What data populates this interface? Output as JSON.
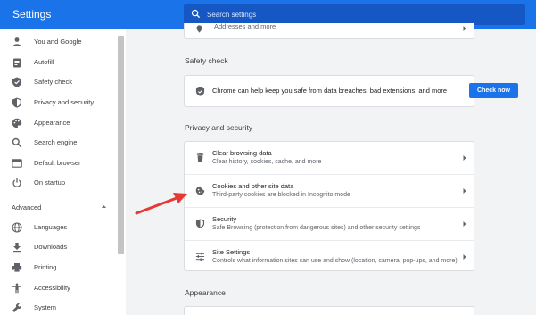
{
  "header": {
    "title": "Settings",
    "search_placeholder": "Search settings"
  },
  "sidebar": {
    "items": [
      {
        "label": "You and Google",
        "icon": "person-icon"
      },
      {
        "label": "Autofill",
        "icon": "clipboard-icon"
      },
      {
        "label": "Safety check",
        "icon": "shield-check-icon"
      },
      {
        "label": "Privacy and security",
        "icon": "shield-icon"
      },
      {
        "label": "Appearance",
        "icon": "palette-icon"
      },
      {
        "label": "Search engine",
        "icon": "search-icon"
      },
      {
        "label": "Default browser",
        "icon": "browser-icon"
      },
      {
        "label": "On startup",
        "icon": "power-icon"
      }
    ],
    "advanced_label": "Advanced",
    "advanced_items": [
      {
        "label": "Languages",
        "icon": "globe-icon"
      },
      {
        "label": "Downloads",
        "icon": "download-icon"
      },
      {
        "label": "Printing",
        "icon": "printer-icon"
      },
      {
        "label": "Accessibility",
        "icon": "accessibility-icon"
      },
      {
        "label": "System",
        "icon": "wrench-icon"
      }
    ]
  },
  "main": {
    "top_partial_row": "Addresses and more",
    "safety_check": {
      "title": "Safety check",
      "text": "Chrome can help keep you safe from data breaches, bad extensions, and more",
      "button": "Check now"
    },
    "privacy": {
      "title": "Privacy and security",
      "rows": [
        {
          "title": "Clear browsing data",
          "subtitle": "Clear history, cookies, cache, and more",
          "icon": "trash-icon"
        },
        {
          "title": "Cookies and other site data",
          "subtitle": "Third-party cookies are blocked in Incognito mode",
          "icon": "cookie-icon"
        },
        {
          "title": "Security",
          "subtitle": "Safe Browsing (protection from dangerous sites) and other security settings",
          "icon": "shield-icon"
        },
        {
          "title": "Site Settings",
          "subtitle": "Controls what information sites can use and show (location, camera, pop-ups, and more)",
          "icon": "sliders-icon"
        }
      ]
    },
    "appearance_title": "Appearance"
  },
  "colors": {
    "brand": "#1a73e8",
    "annotation_arrow": "#e53935"
  }
}
